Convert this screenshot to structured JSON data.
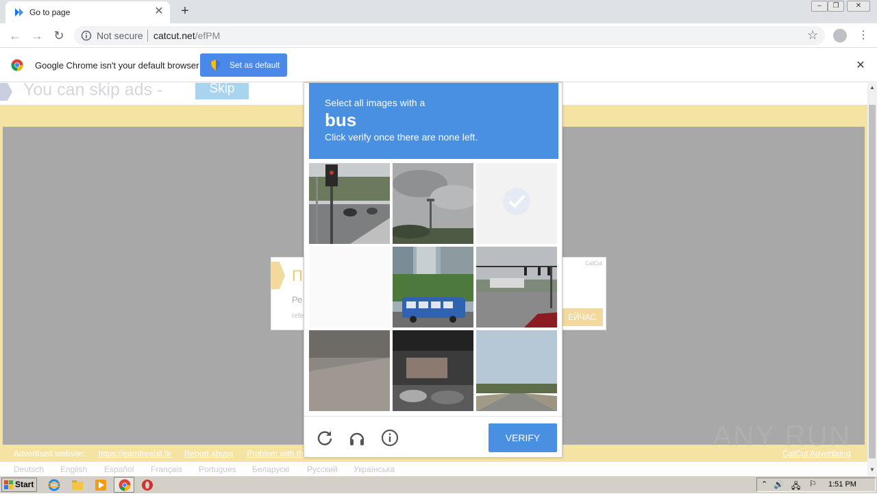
{
  "browser": {
    "tab_title": "Go to page",
    "url_security": "Not secure",
    "url_domain": "catcut.net",
    "url_path": "/efPM"
  },
  "infobar": {
    "message": "Google Chrome isn't your default browser",
    "button": "Set as default"
  },
  "page": {
    "skip_text": "You can skip ads  -",
    "skip_button": "Skip",
    "ad_heading": "П",
    "ad_line": "Ре",
    "ad_line2": "refe",
    "ad_brand": "CatCut",
    "ad_cta": "ЕЙЧАС",
    "footer": {
      "advertised_label": "Advertised website:",
      "advertised_link": "https://earnfreebit.tk",
      "report": "Report abuse",
      "problem": "Problem with the",
      "right_link": "CatCut Advertising"
    },
    "languages": [
      "Deutsch",
      "English",
      "Español",
      "Français",
      "Portugues",
      "Беларускі",
      "Русский",
      "Українська"
    ]
  },
  "captcha": {
    "line1": "Select all images with a",
    "object": "bus",
    "line3": "Click verify once there are none left.",
    "verify": "VERIFY",
    "tiles": [
      {
        "name": "tile-traffic-light",
        "state": "image"
      },
      {
        "name": "tile-tower-sky",
        "state": "image"
      },
      {
        "name": "tile-selected-fading",
        "state": "fading"
      },
      {
        "name": "tile-loading-blank",
        "state": "fading"
      },
      {
        "name": "tile-blue-bus",
        "state": "image"
      },
      {
        "name": "tile-intersection",
        "state": "image"
      },
      {
        "name": "tile-concrete-wall",
        "state": "image"
      },
      {
        "name": "tile-parking-garage",
        "state": "image"
      },
      {
        "name": "tile-road-trees",
        "state": "image"
      }
    ]
  },
  "watermark": "ANY  RUN",
  "taskbar": {
    "start": "Start",
    "clock": "1:51 PM"
  },
  "colors": {
    "accent": "#4a90e2",
    "page_bg": "#f5e3a4",
    "gray_area": "#a8a8a8"
  }
}
